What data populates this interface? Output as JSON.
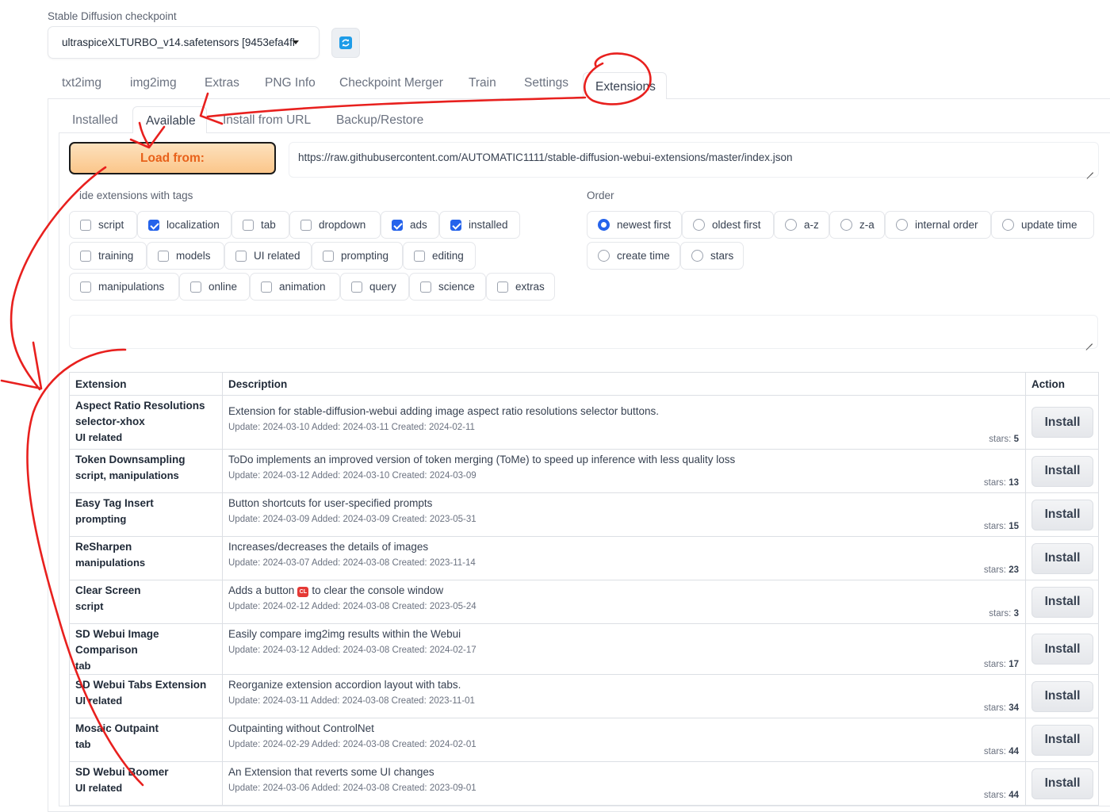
{
  "checkpoint": {
    "label": "Stable Diffusion checkpoint",
    "value": "ultraspiceXLTURBO_v14.safetensors [9453efa4fl"
  },
  "top_tabs": [
    "txt2img",
    "img2img",
    "Extras",
    "PNG Info",
    "Checkpoint Merger",
    "Train",
    "Settings",
    "Extensions"
  ],
  "sub_tabs": [
    "Installed",
    "Available",
    "Install from URL",
    "Backup/Restore"
  ],
  "load_button": "Load from:",
  "url_value": "https://raw.githubusercontent.com/AUTOMATIC1111/stable-diffusion-webui-extensions/master/index.json",
  "hide_tags": {
    "label": "ide extensions with tags",
    "options": [
      {
        "label": "script",
        "checked": false
      },
      {
        "label": "localization",
        "checked": true
      },
      {
        "label": "tab",
        "checked": false
      },
      {
        "label": "dropdown",
        "checked": false
      },
      {
        "label": "ads",
        "checked": true
      },
      {
        "label": "installed",
        "checked": true
      },
      {
        "label": "training",
        "checked": false
      },
      {
        "label": "models",
        "checked": false
      },
      {
        "label": "UI related",
        "checked": false
      },
      {
        "label": "prompting",
        "checked": false
      },
      {
        "label": "editing",
        "checked": false
      },
      {
        "label": "manipulations",
        "checked": false
      },
      {
        "label": "online",
        "checked": false
      },
      {
        "label": "animation",
        "checked": false
      },
      {
        "label": "query",
        "checked": false
      },
      {
        "label": "science",
        "checked": false
      },
      {
        "label": "extras",
        "checked": false
      }
    ]
  },
  "order": {
    "label": "Order",
    "options": [
      "newest first",
      "oldest first",
      "a-z",
      "z-a",
      "internal order",
      "update time",
      "create time",
      "stars"
    ],
    "selected": "newest first"
  },
  "table": {
    "headers": [
      "Extension",
      "Description",
      "Action"
    ],
    "rows": [
      {
        "name": "Aspect Ratio Resolutions selector-xhox",
        "tags": "UI related",
        "desc": "Extension for stable-diffusion-webui adding image aspect ratio resolutions selector buttons.",
        "meta": "Update: 2024-03-10 Added: 2024-03-11 Created: 2024-02-11",
        "stars_label": "stars:",
        "stars": "5",
        "action": "Install"
      },
      {
        "name": "Token Downsampling",
        "tags": "script, manipulations",
        "desc": "ToDo implements an improved version of token merging (ToMe) to speed up inference with less quality loss",
        "meta": "Update: 2024-03-12 Added: 2024-03-10 Created: 2024-03-09",
        "stars_label": "stars:",
        "stars": "13",
        "action": "Install"
      },
      {
        "name": "Easy Tag Insert",
        "tags": "prompting",
        "desc": "Button shortcuts for user-specified prompts",
        "meta": "Update: 2024-03-09 Added: 2024-03-09 Created: 2023-05-31",
        "stars_label": "stars:",
        "stars": "15",
        "action": "Install"
      },
      {
        "name": "ReSharpen",
        "tags": "manipulations",
        "desc": "Increases/decreases the details of images",
        "meta": "Update: 2024-03-07 Added: 2024-03-08 Created: 2023-11-14",
        "stars_label": "stars:",
        "stars": "23",
        "action": "Install"
      },
      {
        "name": "Clear Screen",
        "tags": "script",
        "desc_before": "Adds a button",
        "badge": "CL",
        "desc_after": "to clear the console window",
        "meta": "Update: 2024-02-12 Added: 2024-03-08 Created: 2023-05-24",
        "stars_label": "stars:",
        "stars": "3",
        "action": "Install"
      },
      {
        "name": "SD Webui Image Comparison",
        "tags": "tab",
        "desc": "Easily compare img2img results within the Webui",
        "meta": "Update: 2024-03-12 Added: 2024-03-08 Created: 2024-02-17",
        "stars_label": "stars:",
        "stars": "17",
        "action": "Install"
      },
      {
        "name": "SD Webui Tabs Extension",
        "tags": "UI related",
        "desc": "Reorganize extension accordion layout with tabs.",
        "meta": "Update: 2024-03-11 Added: 2024-03-08 Created: 2023-11-01",
        "stars_label": "stars:",
        "stars": "34",
        "action": "Install"
      },
      {
        "name": "Mosaic Outpaint",
        "tags": "tab",
        "desc": "Outpainting without ControlNet",
        "meta": "Update: 2024-02-29 Added: 2024-03-08 Created: 2024-02-01",
        "stars_label": "stars:",
        "stars": "44",
        "action": "Install"
      },
      {
        "name": "SD Webui Boomer",
        "tags": "UI related",
        "desc": "An Extension that reverts some UI changes",
        "meta": "Update: 2024-03-06 Added: 2024-03-08 Created: 2023-09-01",
        "stars_label": "stars:",
        "stars": "44",
        "action": "Install"
      }
    ]
  },
  "colors": {
    "accent": "#2563eb",
    "load_button_text": "#e8611a",
    "annotation": "#e8201e"
  }
}
